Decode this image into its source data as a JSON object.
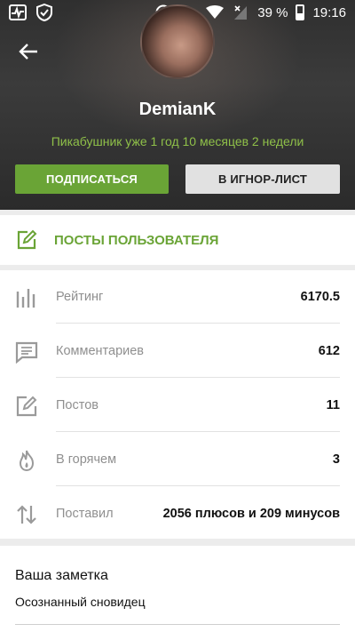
{
  "status_bar": {
    "battery_percent": "39 %",
    "time": "19:16",
    "icons": [
      "activity-icon",
      "shield-icon",
      "add-circle-icon",
      "key-icon",
      "wifi-icon",
      "signal-icon",
      "battery-icon"
    ]
  },
  "profile": {
    "username": "DemianK",
    "member_since": "Пикабушник уже 1 год 10 месяцев 2 недели",
    "subscribe_label": "ПОДПИСАТЬСЯ",
    "ignore_label": "В ИГНОР-ЛИСТ"
  },
  "posts_link": {
    "label": "ПОСТЫ ПОЛЬЗОВАТЕЛЯ"
  },
  "stats": [
    {
      "icon": "rating-bars-icon",
      "label": "Рейтинг",
      "value": "6170.5"
    },
    {
      "icon": "comment-icon",
      "label": "Комментариев",
      "value": "612"
    },
    {
      "icon": "edit-post-icon",
      "label": "Постов",
      "value": "11"
    },
    {
      "icon": "fire-icon",
      "label": "В горячем",
      "value": "3"
    },
    {
      "icon": "up-down-arrows-icon",
      "label": "Поставил",
      "value": "2056 плюсов и 209 минусов"
    }
  ],
  "note": {
    "title": "Ваша заметка",
    "text": "Осознанный сновидец"
  },
  "colors": {
    "accent_green": "#6aa436",
    "since_green": "#8fc049",
    "header_dark": "#333333"
  }
}
